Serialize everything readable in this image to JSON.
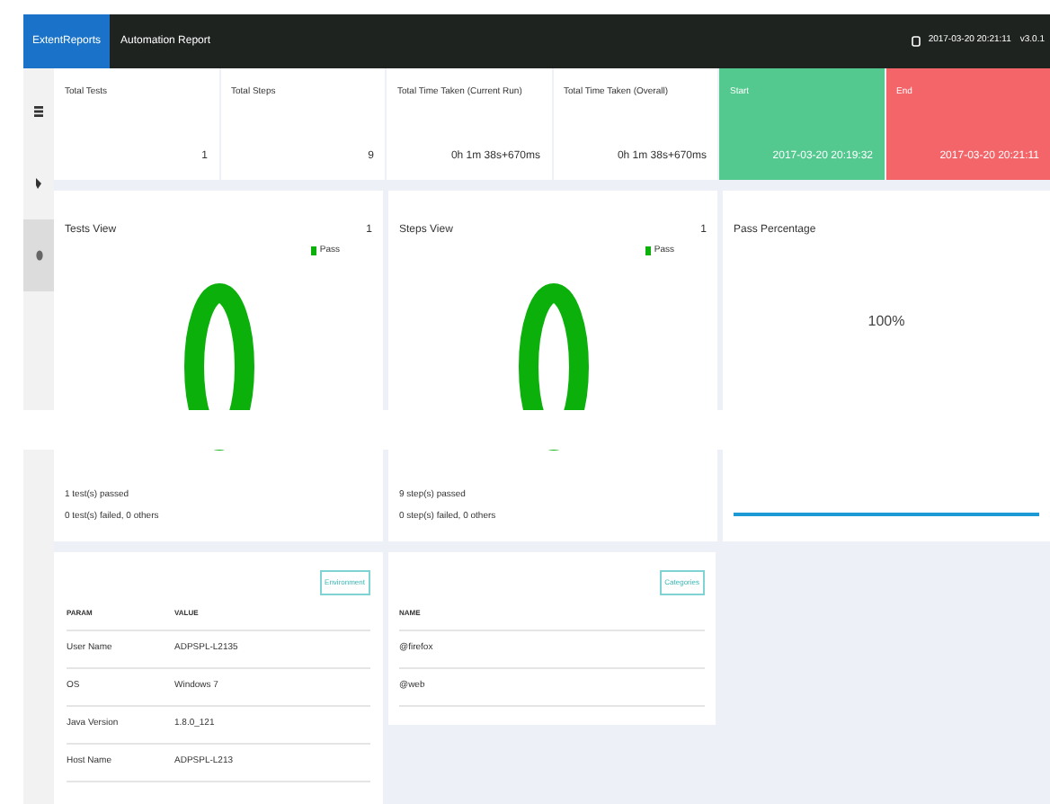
{
  "navbar": {
    "brand": "ExtentReports",
    "title": "Automation Report",
    "timestamp": "2017-03-20 20:21:11",
    "version": "v3.0.1"
  },
  "sidebar": {
    "items": [
      {
        "kind": "tests",
        "selected": false
      },
      {
        "kind": "steps",
        "selected": false
      },
      {
        "kind": "dashboard",
        "selected": true
      }
    ]
  },
  "summary": [
    {
      "kind": "plain",
      "label": "Total Tests",
      "value": "1"
    },
    {
      "kind": "plain",
      "label": "Total Steps",
      "value": "9"
    },
    {
      "kind": "plain",
      "label": "Total Time Taken (Current Run)",
      "value": "0h 1m 38s+670ms"
    },
    {
      "kind": "plain",
      "label": "Total Time Taken (Overall)",
      "value": "0h 1m 38s+670ms"
    },
    {
      "kind": "start",
      "label": "Start",
      "value": "2017-03-20 20:19:32"
    },
    {
      "kind": "end",
      "label": "End",
      "value": "2017-03-20 20:21:11"
    }
  ],
  "charts": [
    {
      "title": "Tests View",
      "count": "1",
      "legend": "Pass",
      "passed": "1 test(s) passed",
      "failed": "0 test(s) failed, 0 others"
    },
    {
      "title": "Steps View",
      "count": "1",
      "legend": "Pass",
      "passed": "9 step(s) passed",
      "failed": "0 step(s) failed, 0 others"
    }
  ],
  "pass_percentage": {
    "title": "Pass Percentage",
    "value": "100%"
  },
  "environment": {
    "badge": "Environment",
    "columns": [
      "PARAM",
      "VALUE"
    ],
    "rows": [
      [
        "User Name",
        "ADPSPL-L2135"
      ],
      [
        "OS",
        "Windows 7"
      ],
      [
        "Java Version",
        "1.8.0_121"
      ],
      [
        "Host Name",
        "ADPSPL-L213"
      ]
    ]
  },
  "categories": {
    "badge": "Categories",
    "columns": [
      "NAME"
    ],
    "rows": [
      [
        "@firefox"
      ],
      [
        "@web"
      ]
    ]
  }
}
